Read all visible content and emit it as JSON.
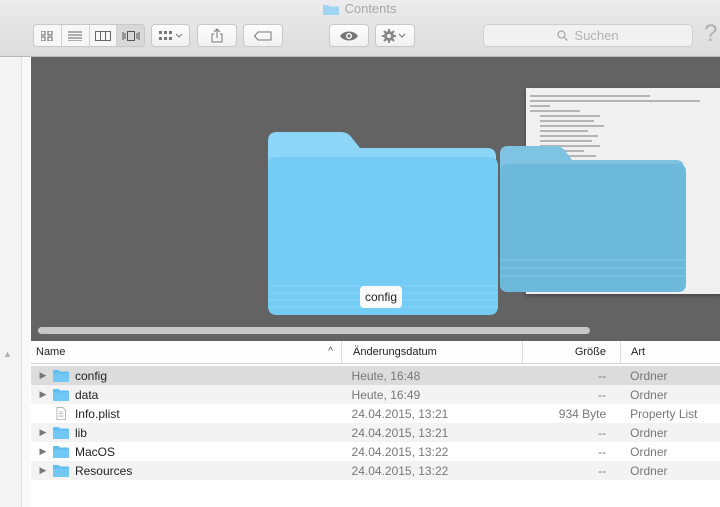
{
  "window": {
    "title": "Contents"
  },
  "toolbar": {
    "view_icon": "icon-view-icon",
    "list_view": "list-view-icon",
    "column_view": "column-view-icon",
    "coverflow_view": "coverflow-view-icon",
    "arrange_icon": "arrange-icon",
    "share_icon": "share-icon",
    "tag_icon": "tag-icon",
    "quicklook_icon": "eye-icon",
    "action_icon": "gear-icon",
    "search_placeholder": "Suchen",
    "help": "?"
  },
  "coverflow": {
    "selected_label": "config"
  },
  "list": {
    "columns": {
      "name": "Name",
      "date": "Änderungsdatum",
      "size": "Größe",
      "kind": "Art"
    },
    "rows": [
      {
        "name": "config",
        "date": "Heute, 16:48",
        "size": "--",
        "kind": "Ordner",
        "type": "folder"
      },
      {
        "name": "data",
        "date": "Heute, 16:49",
        "size": "--",
        "kind": "Ordner",
        "type": "folder"
      },
      {
        "name": "Info.plist",
        "date": "24.04.2015, 13:21",
        "size": "934 Byte",
        "kind": "Property List",
        "type": "file"
      },
      {
        "name": "lib",
        "date": "24.04.2015, 13:21",
        "size": "--",
        "kind": "Ordner",
        "type": "folder"
      },
      {
        "name": "MacOS",
        "date": "24.04.2015, 13:22",
        "size": "--",
        "kind": "Ordner",
        "type": "folder"
      },
      {
        "name": "Resources",
        "date": "24.04.2015, 13:22",
        "size": "--",
        "kind": "Ordner",
        "type": "folder"
      }
    ]
  },
  "colors": {
    "folder": "#6ec9f6",
    "coverflow_bg": "#636363",
    "selection": "#dcdcdc"
  }
}
